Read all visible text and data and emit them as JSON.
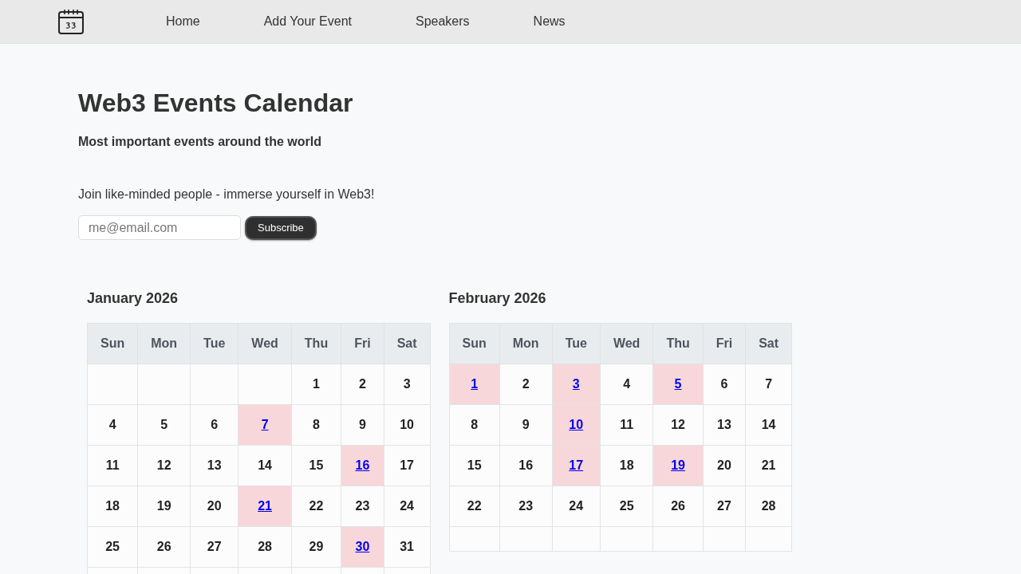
{
  "nav": {
    "links": [
      "Home",
      "Add Your Event",
      "Speakers",
      "News"
    ]
  },
  "header": {
    "title": "Web3 Events Calendar",
    "subtitle": "Most important events around the world"
  },
  "subscribe": {
    "prompt": "Join like-minded people - immerse yourself in Web3!",
    "email": {
      "placeholder": "me@email.com"
    },
    "button": "Subscribe"
  },
  "months": [
    {
      "title": "January 2026",
      "weekdays": [
        "Sun",
        "Mon",
        "Tue",
        "Wed",
        "Thu",
        "Fri",
        "Sat"
      ],
      "weeks": [
        [
          {
            "kind": "blank"
          },
          {
            "kind": "blank"
          },
          {
            "kind": "blank"
          },
          {
            "kind": "blank"
          },
          {
            "kind": "day",
            "day": "1",
            "has_event": false
          },
          {
            "kind": "day",
            "day": "2",
            "has_event": false
          },
          {
            "kind": "day",
            "day": "3",
            "has_event": false
          }
        ],
        [
          {
            "kind": "day",
            "day": "4",
            "has_event": false
          },
          {
            "kind": "day",
            "day": "5",
            "has_event": false
          },
          {
            "kind": "day",
            "day": "6",
            "has_event": false
          },
          {
            "kind": "day",
            "day": "7",
            "has_event": true
          },
          {
            "kind": "day",
            "day": "8",
            "has_event": false
          },
          {
            "kind": "day",
            "day": "9",
            "has_event": false
          },
          {
            "kind": "day",
            "day": "10",
            "has_event": false
          }
        ],
        [
          {
            "kind": "day",
            "day": "11",
            "has_event": false
          },
          {
            "kind": "day",
            "day": "12",
            "has_event": false
          },
          {
            "kind": "day",
            "day": "13",
            "has_event": false
          },
          {
            "kind": "day",
            "day": "14",
            "has_event": false
          },
          {
            "kind": "day",
            "day": "15",
            "has_event": false
          },
          {
            "kind": "day",
            "day": "16",
            "has_event": true
          },
          {
            "kind": "day",
            "day": "17",
            "has_event": false
          }
        ],
        [
          {
            "kind": "day",
            "day": "18",
            "has_event": false
          },
          {
            "kind": "day",
            "day": "19",
            "has_event": false
          },
          {
            "kind": "day",
            "day": "20",
            "has_event": false
          },
          {
            "kind": "day",
            "day": "21",
            "has_event": true
          },
          {
            "kind": "day",
            "day": "22",
            "has_event": false
          },
          {
            "kind": "day",
            "day": "23",
            "has_event": false
          },
          {
            "kind": "day",
            "day": "24",
            "has_event": false
          }
        ],
        [
          {
            "kind": "day",
            "day": "25",
            "has_event": false
          },
          {
            "kind": "day",
            "day": "26",
            "has_event": false
          },
          {
            "kind": "day",
            "day": "27",
            "has_event": false
          },
          {
            "kind": "day",
            "day": "28",
            "has_event": false
          },
          {
            "kind": "day",
            "day": "29",
            "has_event": false
          },
          {
            "kind": "day",
            "day": "30",
            "has_event": true
          },
          {
            "kind": "day",
            "day": "31",
            "has_event": false
          }
        ],
        [
          {
            "kind": "blank"
          },
          {
            "kind": "blank"
          },
          {
            "kind": "blank"
          },
          {
            "kind": "blank"
          },
          {
            "kind": "blank"
          },
          {
            "kind": "blank"
          },
          {
            "kind": "blank"
          }
        ]
      ]
    },
    {
      "title": "February 2026",
      "weekdays": [
        "Sun",
        "Mon",
        "Tue",
        "Wed",
        "Thu",
        "Fri",
        "Sat"
      ],
      "weeks": [
        [
          {
            "kind": "day",
            "day": "1",
            "has_event": true
          },
          {
            "kind": "day",
            "day": "2",
            "has_event": false
          },
          {
            "kind": "day",
            "day": "3",
            "has_event": true
          },
          {
            "kind": "day",
            "day": "4",
            "has_event": false
          },
          {
            "kind": "day",
            "day": "5",
            "has_event": true
          },
          {
            "kind": "day",
            "day": "6",
            "has_event": false
          },
          {
            "kind": "day",
            "day": "7",
            "has_event": false
          }
        ],
        [
          {
            "kind": "day",
            "day": "8",
            "has_event": false
          },
          {
            "kind": "day",
            "day": "9",
            "has_event": false
          },
          {
            "kind": "day",
            "day": "10",
            "has_event": true
          },
          {
            "kind": "day",
            "day": "11",
            "has_event": false
          },
          {
            "kind": "day",
            "day": "12",
            "has_event": false
          },
          {
            "kind": "day",
            "day": "13",
            "has_event": false
          },
          {
            "kind": "day",
            "day": "14",
            "has_event": false
          }
        ],
        [
          {
            "kind": "day",
            "day": "15",
            "has_event": false
          },
          {
            "kind": "day",
            "day": "16",
            "has_event": false
          },
          {
            "kind": "day",
            "day": "17",
            "has_event": true
          },
          {
            "kind": "day",
            "day": "18",
            "has_event": false
          },
          {
            "kind": "day",
            "day": "19",
            "has_event": true
          },
          {
            "kind": "day",
            "day": "20",
            "has_event": false
          },
          {
            "kind": "day",
            "day": "21",
            "has_event": false
          }
        ],
        [
          {
            "kind": "day",
            "day": "22",
            "has_event": false
          },
          {
            "kind": "day",
            "day": "23",
            "has_event": false
          },
          {
            "kind": "day",
            "day": "24",
            "has_event": false
          },
          {
            "kind": "day",
            "day": "25",
            "has_event": false
          },
          {
            "kind": "day",
            "day": "26",
            "has_event": false
          },
          {
            "kind": "day",
            "day": "27",
            "has_event": false
          },
          {
            "kind": "day",
            "day": "28",
            "has_event": false
          }
        ],
        [
          {
            "kind": "blank"
          },
          {
            "kind": "blank"
          },
          {
            "kind": "blank"
          },
          {
            "kind": "blank"
          },
          {
            "kind": "blank"
          },
          {
            "kind": "blank"
          },
          {
            "kind": "blank"
          }
        ]
      ]
    }
  ]
}
